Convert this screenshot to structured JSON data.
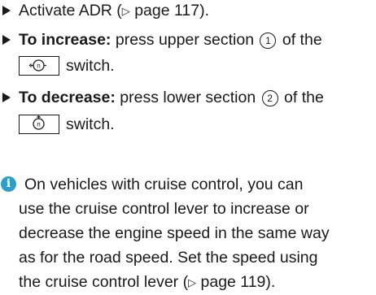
{
  "steps": [
    {
      "text_before": "Activate ADR (",
      "ref_symbol": "▷",
      "ref_text": " page 117)."
    },
    {
      "bold": "To increase:",
      "text": " press upper section ",
      "num": "1",
      "after": " of the",
      "switch_text": "switch.",
      "icon": "adr-plus-switch-icon"
    },
    {
      "bold": "To decrease:",
      "text": " press lower section ",
      "num": "2",
      "after": " of the",
      "switch_text": "switch.",
      "icon": "adr-minus-switch-icon"
    }
  ],
  "note": {
    "icon": "info-icon",
    "icon_glyph": "i",
    "lines": [
      "On vehicles with cruise control, you can",
      "use the cruise control lever to increase or",
      "decrease the engine speed in the same way",
      "as for the road speed. Set the speed using"
    ],
    "last_line_before": "the cruise control lever (",
    "ref_symbol": "▷",
    "last_line_after": " page 119)."
  }
}
